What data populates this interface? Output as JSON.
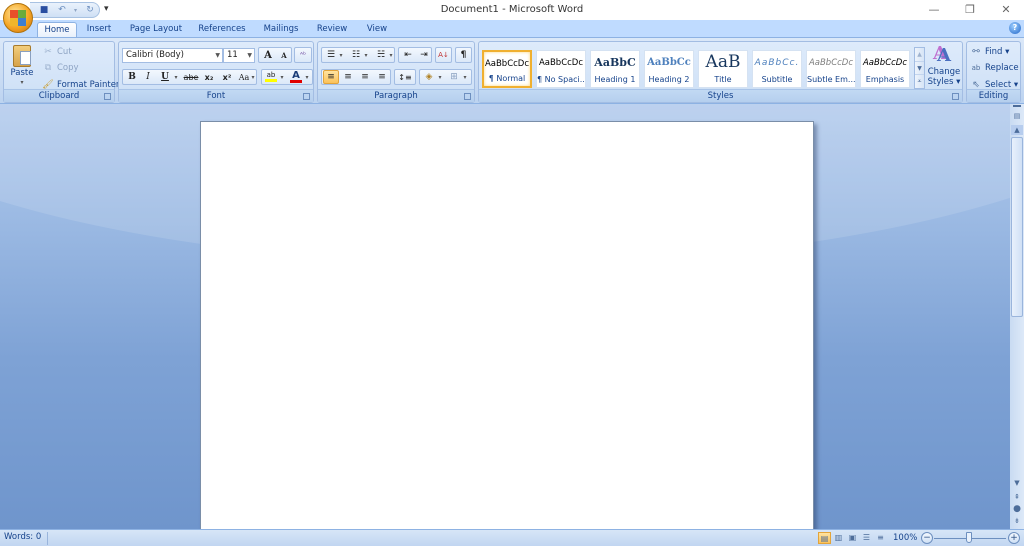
{
  "window": {
    "title": "Document1 - Microsoft Word",
    "controls": {
      "minimize": "—",
      "restore": "❐",
      "close": "✕"
    }
  },
  "quick_access": {
    "items": [
      {
        "name": "save-icon",
        "glyph": "💾"
      },
      {
        "name": "undo-icon",
        "glyph": "↶"
      },
      {
        "name": "undo-dropdown",
        "glyph": "▾"
      },
      {
        "name": "redo-icon",
        "glyph": "↻"
      }
    ],
    "customize_glyph": "⩡"
  },
  "tabs": [
    {
      "label": "Home",
      "active": true
    },
    {
      "label": "Insert"
    },
    {
      "label": "Page Layout"
    },
    {
      "label": "References"
    },
    {
      "label": "Mailings"
    },
    {
      "label": "Review"
    },
    {
      "label": "View"
    }
  ],
  "help_glyph": "?",
  "ribbon": {
    "clipboard": {
      "label": "Clipboard",
      "paste": "Paste",
      "cut": "Cut",
      "copy": "Copy",
      "format_painter": "Format Painter",
      "cut_enabled": false,
      "copy_enabled": false
    },
    "font": {
      "label": "Font",
      "font_name": "Calibri (Body)",
      "font_size": "11",
      "grow": "A",
      "shrink": "A",
      "clear": "ᴬᵇ",
      "bold": "B",
      "italic": "I",
      "underline": "U",
      "strike": "abe",
      "subscript": "x₂",
      "superscript": "x²",
      "change_case": "Aa",
      "highlight": "ab",
      "font_color": "A",
      "highlight_color": "#ffff00",
      "font_color_value": "#e00000"
    },
    "paragraph": {
      "label": "Paragraph",
      "bullets": "☰",
      "numbering": "☷",
      "multilevel": "☵",
      "decrease_indent": "⇤",
      "increase_indent": "⇥",
      "sort": "A↓",
      "show_marks": "¶",
      "align_left": "≡",
      "center": "≡",
      "align_right": "≡",
      "justify": "≡",
      "line_spacing": "↕≡",
      "shading": "◈",
      "borders": "⊞",
      "active_alignment": "left"
    },
    "styles": {
      "label": "Styles",
      "items": [
        {
          "preview": "AaBbCcDc",
          "name": "¶ Normal",
          "selected": true
        },
        {
          "preview": "AaBbCcDc",
          "name": "¶ No Spaci..."
        },
        {
          "preview": "AaBbC",
          "name": "Heading 1"
        },
        {
          "preview": "AaBbCc",
          "name": "Heading 2"
        },
        {
          "preview": "AaB",
          "name": "Title"
        },
        {
          "preview": "AaBbCc.",
          "name": "Subtitle"
        },
        {
          "preview": "AaBbCcDc",
          "name": "Subtle Em..."
        },
        {
          "preview": "AaBbCcDc",
          "name": "Emphasis"
        }
      ],
      "change_styles": "Change",
      "change_styles_2": "Styles ▾"
    },
    "editing": {
      "label": "Editing",
      "find": "Find ▾",
      "replace": "Replace",
      "select": "Select ▾"
    }
  },
  "statusbar": {
    "words": "Words: 0",
    "zoom": "100%",
    "zoom_out": "−",
    "zoom_in": "+",
    "zoom_percent": 100
  }
}
